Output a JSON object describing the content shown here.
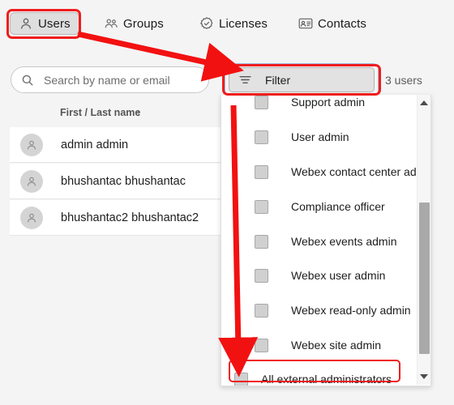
{
  "tabs": [
    {
      "id": "users",
      "label": "Users",
      "icon": "user-icon",
      "active": true
    },
    {
      "id": "groups",
      "label": "Groups",
      "icon": "groups-icon",
      "active": false
    },
    {
      "id": "licenses",
      "label": "Licenses",
      "icon": "badge-check-icon",
      "active": false
    },
    {
      "id": "contacts",
      "label": "Contacts",
      "icon": "contact-card-icon",
      "active": false
    }
  ],
  "search": {
    "placeholder": "Search by name or email",
    "value": "",
    "icon": "search-icon"
  },
  "filter": {
    "label": "Filter",
    "icon": "filter-lines-icon",
    "expanded": true
  },
  "user_count_label": "3 users",
  "table": {
    "column_header": "First / Last name",
    "sort_indicator": "↑",
    "rows": [
      {
        "name": "admin admin",
        "avatar": "avatar-icon"
      },
      {
        "name": "bhushantac bhushantac",
        "avatar": "avatar-icon"
      },
      {
        "name": "bhushantac2 bhushantac2",
        "avatar": "avatar-icon"
      }
    ]
  },
  "dropdown": {
    "items": [
      {
        "label": "Support admin",
        "checked": false,
        "clipped": true
      },
      {
        "label": "User admin",
        "checked": false
      },
      {
        "label": "Webex contact center admin",
        "checked": false
      },
      {
        "label": "Compliance officer",
        "checked": false
      },
      {
        "label": "Webex events admin",
        "checked": false
      },
      {
        "label": "Webex user admin",
        "checked": false
      },
      {
        "label": "Webex read-only admin",
        "checked": false
      },
      {
        "label": "Webex site admin",
        "checked": false
      },
      {
        "label": "All external administrators",
        "checked": false,
        "highlighted": true
      }
    ],
    "scrollbar": {
      "up_icon": "scroll-up-arrow-icon",
      "down_icon": "scroll-down-arrow-icon"
    }
  },
  "annotations": {
    "color": "#ef1d1d",
    "highlight_users_tab": true,
    "highlight_filter_button": true,
    "highlight_all_external_administrators": true,
    "arrow_users_to_filter": true,
    "arrow_filter_to_all_external": true
  }
}
